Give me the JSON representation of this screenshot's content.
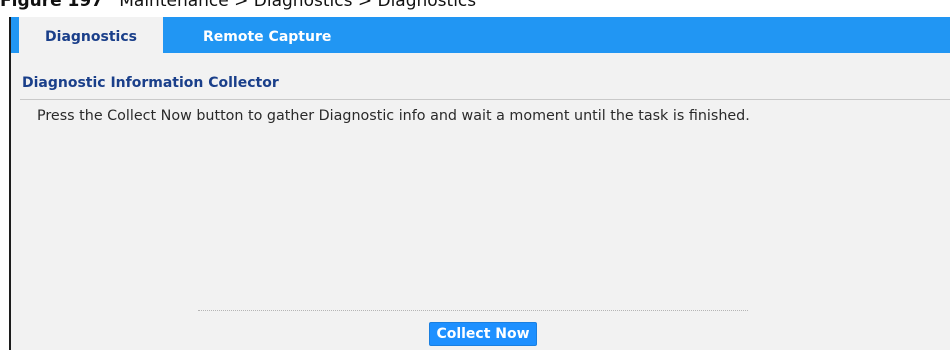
{
  "caption": {
    "figure_number": "Figure 197",
    "text": "Maintenance > Diagnostics > Diagnostics"
  },
  "tabs": [
    {
      "label": "Diagnostics",
      "active": true
    },
    {
      "label": "Remote Capture",
      "active": false
    }
  ],
  "section": {
    "title": "Diagnostic Information Collector",
    "description": "Press the Collect Now button to gather Diagnostic info and wait a moment until the task is finished."
  },
  "actions": {
    "collect_now_label": "Collect Now"
  },
  "colors": {
    "tab_bar": "#2196f3",
    "accent_title": "#1a3f8a",
    "button": "#1e90ff",
    "panel_background": "#f2f2f2"
  }
}
